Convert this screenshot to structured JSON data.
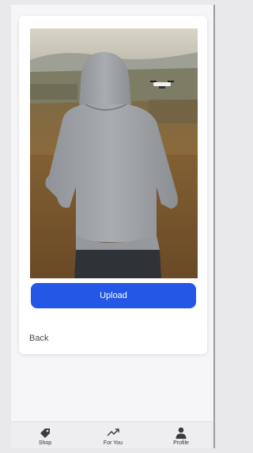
{
  "card": {
    "upload_label": "Upload",
    "back_label": "Back"
  },
  "tabbar": {
    "items": [
      {
        "label": "Shop",
        "icon": "tag-icon"
      },
      {
        "label": "For You",
        "icon": "trending-up-icon"
      },
      {
        "label": "Profile",
        "icon": "person-icon"
      }
    ]
  },
  "colors": {
    "accent": "#2457e6",
    "background": "#f6f6f8",
    "tabbar": "#eeeef0"
  }
}
